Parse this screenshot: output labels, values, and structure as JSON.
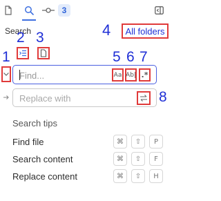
{
  "tabs": {
    "files_icon": "file-icon",
    "search_icon": "search-icon",
    "commit_icon": "commit-icon",
    "badge_count": "3",
    "layout_icon": "sidebar-layout-icon"
  },
  "search": {
    "title": "Search",
    "scope_button": "All folders",
    "find_placeholder": "Find...",
    "replace_placeholder": "Replace with",
    "match_case": "Aa",
    "whole_word": "Ab|",
    "regex": ".*"
  },
  "callouts": [
    "1",
    "2",
    "3",
    "4",
    "5",
    "6",
    "7",
    "8"
  ],
  "tips": {
    "title": "Search tips",
    "rows": [
      {
        "label": "Find file",
        "keys": [
          "⌘",
          "⇧",
          "P"
        ]
      },
      {
        "label": "Search content",
        "keys": [
          "⌘",
          "⇧",
          "F"
        ]
      },
      {
        "label": "Replace content",
        "keys": [
          "⌘",
          "⇧",
          "H"
        ]
      }
    ]
  },
  "colors": {
    "accent": "#3d6fe0",
    "callout_text": "#1f2fd6",
    "highlight_box": "#e03a3a"
  }
}
